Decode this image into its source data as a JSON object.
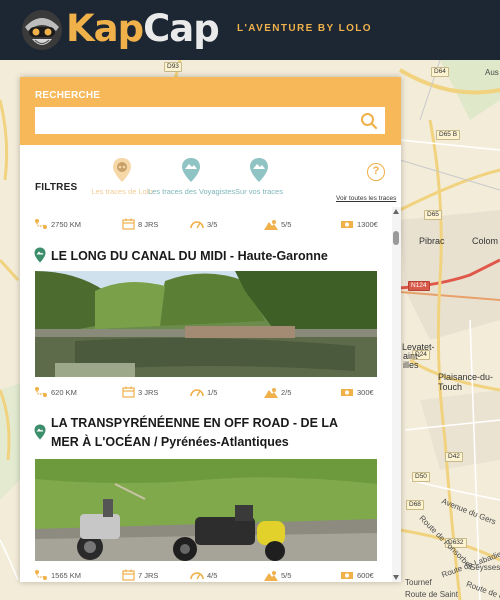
{
  "header": {
    "logo_part1": "Kap",
    "logo_part2": "Cap",
    "tagline": "L'AVENTURE BY LOLO"
  },
  "search": {
    "title": "RECHERCHE",
    "placeholder": "",
    "value": ""
  },
  "filters": {
    "label": "FILTRES",
    "options": [
      {
        "label": "Les traces de Lolo",
        "color": "#f2cd96"
      },
      {
        "label": "Les traces des Voyagistes",
        "color": "#7fb6b8"
      },
      {
        "label": "Sur vos traces",
        "color": "#7fb6b8"
      }
    ],
    "help": "?",
    "see_all": "Voir toutes les traces"
  },
  "trips": [
    {
      "title": "LE LONG DU CANAL DU MIDI - Haute-Garonne",
      "stats": {
        "distance": "620 KM",
        "days": "3 JRS",
        "difficulty": "1/5",
        "scenery": "2/5",
        "budget": "300€"
      }
    },
    {
      "title": "LA TRANSPYRÉNÉENNE EN OFF ROAD - DE LA MER À L'OCÉAN / Pyrénées-Atlantiques",
      "stats": {
        "distance": "1565 KM",
        "days": "7 JRS",
        "difficulty": "4/5",
        "scenery": "5/5",
        "budget": "600€"
      }
    }
  ],
  "top_stats": {
    "distance": "2750 KM",
    "days": "8 JRS",
    "difficulty": "3/5",
    "scenery": "5/5",
    "budget": "1300€"
  },
  "map": {
    "labels": {
      "pibrac": "Pibrac",
      "colomiers": "Colom",
      "plaisance": "Plaisance-du-Touch",
      "levatet": "Levatet-",
      "saint": "aint-",
      "illes": "illes",
      "tournef": "Tournef",
      "seysses": "Seysses",
      "avenue_gers": "Avenue du Gers",
      "route_lablade": "Route de Labadie",
      "route_fonsorbes": "Route de Fonsorbes",
      "route_ca": "Route de Ca...",
      "route_saint": "Route de Saint",
      "aus": "Aus"
    },
    "roads": {
      "d93": "D93",
      "d64": "D64",
      "d65b": "D65 B",
      "d65": "D65",
      "n124": "N124",
      "d24": "D24",
      "d42": "D42",
      "d50": "D50",
      "d68": "D68",
      "d632": "D632"
    }
  },
  "colors": {
    "header_bg": "#1c2733",
    "brand_orange": "#f0b04a",
    "search_bg": "#f6b858",
    "teal": "#7fb6b8",
    "card_pin": "#3c8d6a"
  }
}
